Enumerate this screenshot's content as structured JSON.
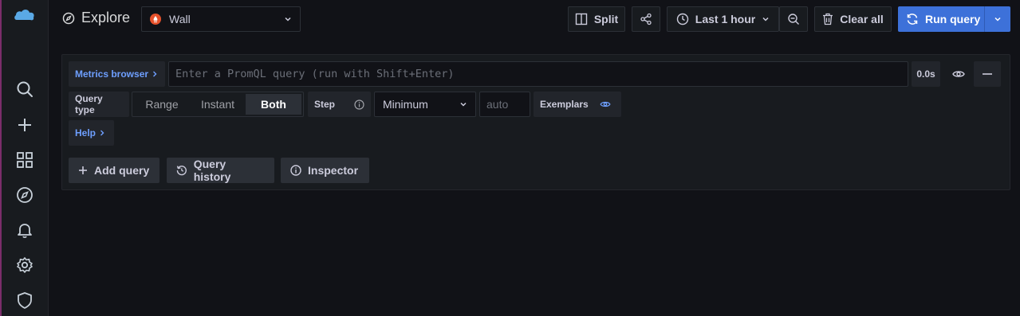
{
  "header": {
    "title": "Explore",
    "datasource": "Wall",
    "split_label": "Split",
    "time_range": "Last 1 hour",
    "clear_label": "Clear all",
    "run_label": "Run query"
  },
  "sidebar": {
    "items": [
      "search-icon",
      "plus-icon",
      "dashboards-icon",
      "explore-icon",
      "alerting-icon",
      "gear-icon",
      "shield-icon"
    ]
  },
  "query": {
    "metrics_browser_label": "Metrics browser",
    "input_placeholder": "Enter a PromQL query (run with Shift+Enter)",
    "duration": "0.0s",
    "query_type_label": "Query type",
    "query_types": [
      "Range",
      "Instant",
      "Both"
    ],
    "selected_query_type": "Both",
    "step_label": "Step",
    "step_value": "Minimum",
    "step_placeholder": "auto",
    "exemplars_label": "Exemplars",
    "help_label": "Help"
  },
  "actions": {
    "add_query": "Add query",
    "query_history": "Query history",
    "inspector": "Inspector"
  },
  "colors": {
    "primary": "#3d71d9",
    "accent_link": "#6e9fff",
    "prometheus": "#e6522c"
  }
}
